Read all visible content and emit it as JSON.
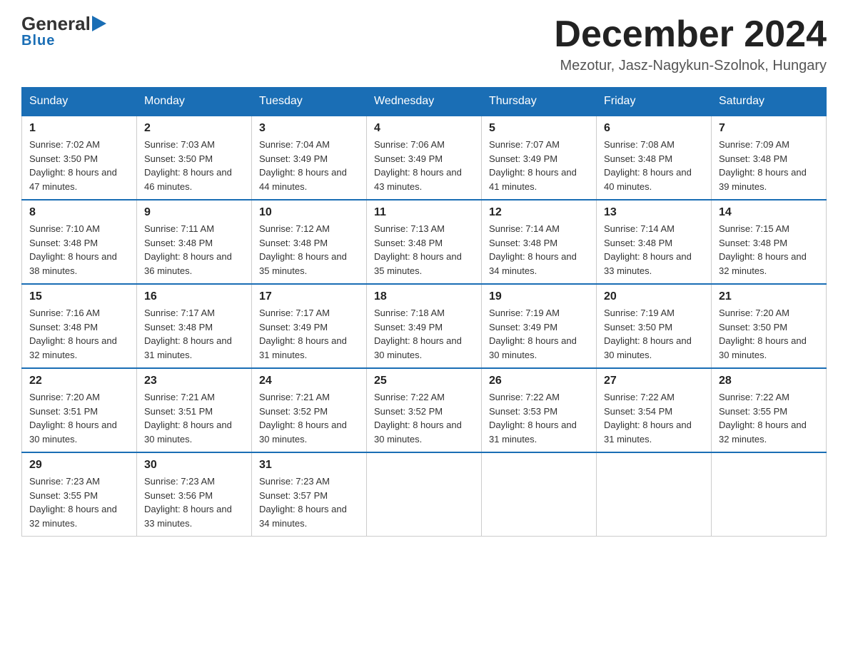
{
  "header": {
    "logo": {
      "general": "General",
      "arrow": "▶",
      "blue": "Blue"
    },
    "title": "December 2024",
    "location": "Mezotur, Jasz-Nagykun-Szolnok, Hungary"
  },
  "days_of_week": [
    "Sunday",
    "Monday",
    "Tuesday",
    "Wednesday",
    "Thursday",
    "Friday",
    "Saturday"
  ],
  "weeks": [
    [
      {
        "day": "1",
        "sunrise": "7:02 AM",
        "sunset": "3:50 PM",
        "daylight": "8 hours and 47 minutes."
      },
      {
        "day": "2",
        "sunrise": "7:03 AM",
        "sunset": "3:50 PM",
        "daylight": "8 hours and 46 minutes."
      },
      {
        "day": "3",
        "sunrise": "7:04 AM",
        "sunset": "3:49 PM",
        "daylight": "8 hours and 44 minutes."
      },
      {
        "day": "4",
        "sunrise": "7:06 AM",
        "sunset": "3:49 PM",
        "daylight": "8 hours and 43 minutes."
      },
      {
        "day": "5",
        "sunrise": "7:07 AM",
        "sunset": "3:49 PM",
        "daylight": "8 hours and 41 minutes."
      },
      {
        "day": "6",
        "sunrise": "7:08 AM",
        "sunset": "3:48 PM",
        "daylight": "8 hours and 40 minutes."
      },
      {
        "day": "7",
        "sunrise": "7:09 AM",
        "sunset": "3:48 PM",
        "daylight": "8 hours and 39 minutes."
      }
    ],
    [
      {
        "day": "8",
        "sunrise": "7:10 AM",
        "sunset": "3:48 PM",
        "daylight": "8 hours and 38 minutes."
      },
      {
        "day": "9",
        "sunrise": "7:11 AM",
        "sunset": "3:48 PM",
        "daylight": "8 hours and 36 minutes."
      },
      {
        "day": "10",
        "sunrise": "7:12 AM",
        "sunset": "3:48 PM",
        "daylight": "8 hours and 35 minutes."
      },
      {
        "day": "11",
        "sunrise": "7:13 AM",
        "sunset": "3:48 PM",
        "daylight": "8 hours and 35 minutes."
      },
      {
        "day": "12",
        "sunrise": "7:14 AM",
        "sunset": "3:48 PM",
        "daylight": "8 hours and 34 minutes."
      },
      {
        "day": "13",
        "sunrise": "7:14 AM",
        "sunset": "3:48 PM",
        "daylight": "8 hours and 33 minutes."
      },
      {
        "day": "14",
        "sunrise": "7:15 AM",
        "sunset": "3:48 PM",
        "daylight": "8 hours and 32 minutes."
      }
    ],
    [
      {
        "day": "15",
        "sunrise": "7:16 AM",
        "sunset": "3:48 PM",
        "daylight": "8 hours and 32 minutes."
      },
      {
        "day": "16",
        "sunrise": "7:17 AM",
        "sunset": "3:48 PM",
        "daylight": "8 hours and 31 minutes."
      },
      {
        "day": "17",
        "sunrise": "7:17 AM",
        "sunset": "3:49 PM",
        "daylight": "8 hours and 31 minutes."
      },
      {
        "day": "18",
        "sunrise": "7:18 AM",
        "sunset": "3:49 PM",
        "daylight": "8 hours and 30 minutes."
      },
      {
        "day": "19",
        "sunrise": "7:19 AM",
        "sunset": "3:49 PM",
        "daylight": "8 hours and 30 minutes."
      },
      {
        "day": "20",
        "sunrise": "7:19 AM",
        "sunset": "3:50 PM",
        "daylight": "8 hours and 30 minutes."
      },
      {
        "day": "21",
        "sunrise": "7:20 AM",
        "sunset": "3:50 PM",
        "daylight": "8 hours and 30 minutes."
      }
    ],
    [
      {
        "day": "22",
        "sunrise": "7:20 AM",
        "sunset": "3:51 PM",
        "daylight": "8 hours and 30 minutes."
      },
      {
        "day": "23",
        "sunrise": "7:21 AM",
        "sunset": "3:51 PM",
        "daylight": "8 hours and 30 minutes."
      },
      {
        "day": "24",
        "sunrise": "7:21 AM",
        "sunset": "3:52 PM",
        "daylight": "8 hours and 30 minutes."
      },
      {
        "day": "25",
        "sunrise": "7:22 AM",
        "sunset": "3:52 PM",
        "daylight": "8 hours and 30 minutes."
      },
      {
        "day": "26",
        "sunrise": "7:22 AM",
        "sunset": "3:53 PM",
        "daylight": "8 hours and 31 minutes."
      },
      {
        "day": "27",
        "sunrise": "7:22 AM",
        "sunset": "3:54 PM",
        "daylight": "8 hours and 31 minutes."
      },
      {
        "day": "28",
        "sunrise": "7:22 AM",
        "sunset": "3:55 PM",
        "daylight": "8 hours and 32 minutes."
      }
    ],
    [
      {
        "day": "29",
        "sunrise": "7:23 AM",
        "sunset": "3:55 PM",
        "daylight": "8 hours and 32 minutes."
      },
      {
        "day": "30",
        "sunrise": "7:23 AM",
        "sunset": "3:56 PM",
        "daylight": "8 hours and 33 minutes."
      },
      {
        "day": "31",
        "sunrise": "7:23 AM",
        "sunset": "3:57 PM",
        "daylight": "8 hours and 34 minutes."
      },
      null,
      null,
      null,
      null
    ]
  ]
}
